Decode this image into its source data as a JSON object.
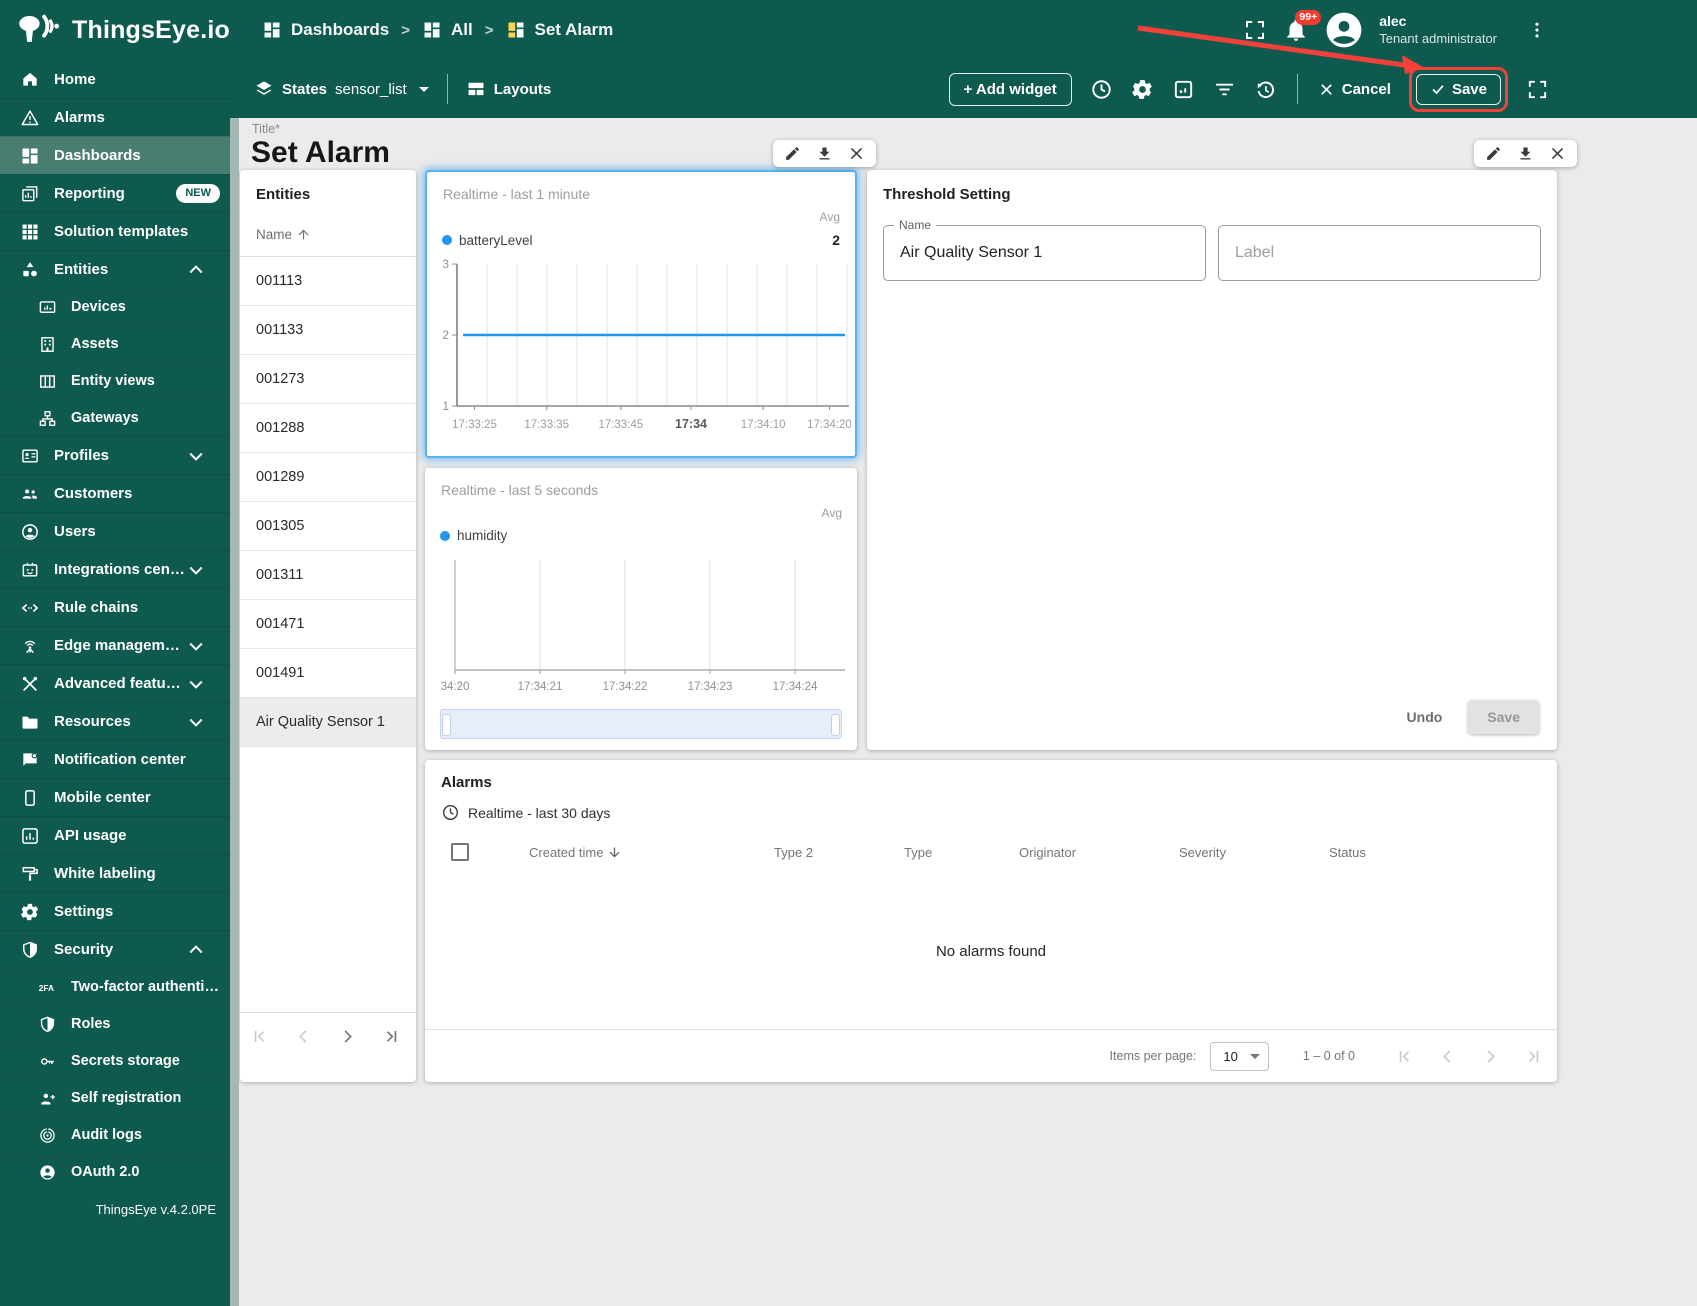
{
  "header": {
    "app_name": "ThingsEye.io",
    "breadcrumbs": [
      "Dashboards",
      "All",
      "Set Alarm"
    ],
    "notifications_badge": "99+",
    "user": {
      "name": "alec",
      "role": "Tenant administrator"
    }
  },
  "toolbar": {
    "states_label": "States",
    "states_value": "sensor_list",
    "layouts_label": "Layouts",
    "add_widget_label": "+ Add widget",
    "cancel_label": "Cancel",
    "save_label": "Save"
  },
  "annotation": {
    "type": "arrow-and-box",
    "target": "save-button",
    "color": "#f2413a"
  },
  "sidebar": {
    "items": [
      {
        "label": "Home",
        "icon": "home"
      },
      {
        "label": "Alarms",
        "icon": "alarms"
      },
      {
        "label": "Dashboards",
        "icon": "dashboards",
        "active": true
      },
      {
        "label": "Reporting",
        "icon": "reporting",
        "badge": "NEW"
      },
      {
        "label": "Solution templates",
        "icon": "solution-templates"
      },
      {
        "label": "Entities",
        "icon": "entities",
        "chevron": "up"
      },
      {
        "label": "Devices",
        "icon": "devices",
        "child": true
      },
      {
        "label": "Assets",
        "icon": "assets",
        "child": true
      },
      {
        "label": "Entity views",
        "icon": "entity-views",
        "child": true
      },
      {
        "label": "Gateways",
        "icon": "gateways",
        "child": true
      },
      {
        "label": "Profiles",
        "icon": "profiles",
        "chevron": "down"
      },
      {
        "label": "Customers",
        "icon": "customers"
      },
      {
        "label": "Users",
        "icon": "users"
      },
      {
        "label": "Integrations center",
        "icon": "integrations",
        "chevron": "down"
      },
      {
        "label": "Rule chains",
        "icon": "rule-chains"
      },
      {
        "label": "Edge management",
        "icon": "edge",
        "chevron": "down"
      },
      {
        "label": "Advanced features",
        "icon": "advanced",
        "chevron": "down"
      },
      {
        "label": "Resources",
        "icon": "resources",
        "chevron": "down"
      },
      {
        "label": "Notification center",
        "icon": "notification"
      },
      {
        "label": "Mobile center",
        "icon": "mobile"
      },
      {
        "label": "API usage",
        "icon": "api"
      },
      {
        "label": "White labeling",
        "icon": "white-labeling"
      },
      {
        "label": "Settings",
        "icon": "settings"
      },
      {
        "label": "Security",
        "icon": "security",
        "chevron": "up"
      },
      {
        "label": "Two-factor authenticati…",
        "icon": "2fa",
        "child": true
      },
      {
        "label": "Roles",
        "icon": "roles",
        "child": true
      },
      {
        "label": "Secrets storage",
        "icon": "secrets",
        "child": true
      },
      {
        "label": "Self registration",
        "icon": "self-registration",
        "child": true
      },
      {
        "label": "Audit logs",
        "icon": "audit",
        "child": true
      },
      {
        "label": "OAuth 2.0",
        "icon": "oauth",
        "child": true
      }
    ],
    "version": "ThingsEye v.4.2.0PE"
  },
  "page": {
    "title_label": "Title*",
    "title": "Set Alarm"
  },
  "entities_widget": {
    "title": "Entities",
    "column": "Name",
    "rows": [
      "001113",
      "001133",
      "001273",
      "001288",
      "001289",
      "001305",
      "001311",
      "001471",
      "001491",
      "Air Quality Sensor 1"
    ],
    "selected_row": "Air Quality Sensor 1"
  },
  "chart_data": [
    {
      "type": "line",
      "title": "Realtime - last 1 minute",
      "series": [
        {
          "name": "batteryLevel",
          "color": "#2196f3",
          "constant_value": 2,
          "aggregation": "Avg",
          "aggregated_value": "2"
        }
      ],
      "x_ticks": [
        "17:33:25",
        "17:33:35",
        "17:33:45",
        "17:34",
        "17:34:10",
        "17:34:20"
      ],
      "x_bold_tick": "17:34",
      "y_ticks": [
        3,
        2,
        1
      ],
      "ylim": [
        1,
        3
      ],
      "grid": "vertical"
    },
    {
      "type": "line",
      "title": "Realtime - last 5 seconds",
      "series": [
        {
          "name": "humidity",
          "color": "#2196f3",
          "values": [],
          "aggregation": "Avg"
        }
      ],
      "x_ticks": [
        "34:20",
        "17:34:21",
        "17:34:22",
        "17:34:23",
        "17:34:24"
      ],
      "ylim": null,
      "grid": "vertical",
      "empty": true,
      "has_range_scrollbar": true
    }
  ],
  "threshold_widget": {
    "title": "Threshold Setting",
    "name_label": "Name",
    "name_value": "Air Quality Sensor 1",
    "label_placeholder": "Label",
    "undo_label": "Undo",
    "save_label": "Save"
  },
  "alarms_widget": {
    "title": "Alarms",
    "timewindow": "Realtime - last 30 days",
    "columns": [
      "Created time",
      "Type 2",
      "Type",
      "Originator",
      "Severity",
      "Status"
    ],
    "sorted_column": "Created time",
    "empty_text": "No alarms found",
    "items_per_page_label": "Items per page:",
    "items_per_page": "10",
    "range_text": "1 – 0 of 0"
  },
  "colors": {
    "brand_teal": "#0e5a4e",
    "active_item": "#4a7d72",
    "accent_blue": "#2196f3",
    "annotation_red": "#f2413a",
    "badge_red": "#f43a2e",
    "content_bg": "#ebebeb"
  }
}
